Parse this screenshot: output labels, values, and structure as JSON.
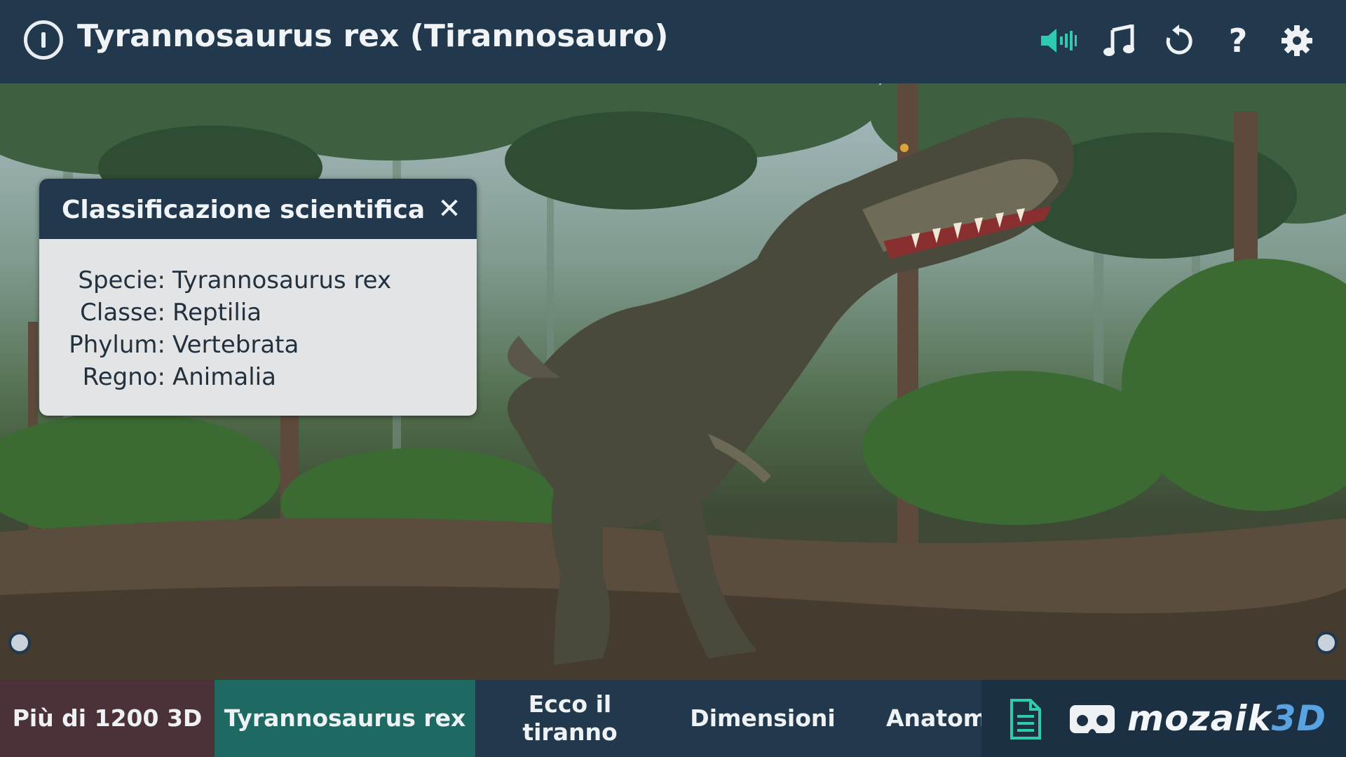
{
  "header": {
    "title": "Tyrannosaurus rex (Tirannosauro)",
    "icons": [
      "power-icon",
      "speaker-icon",
      "music-note-icon",
      "refresh-icon",
      "help-icon",
      "gear-icon"
    ],
    "accent_color": "#2fcbb0"
  },
  "panel": {
    "title": "Classificazione scientifica",
    "close_symbol": "✕",
    "rows": [
      {
        "label": "Specie:",
        "value": "Tyrannosaurus rex"
      },
      {
        "label": "Classe:",
        "value": "Reptilia"
      },
      {
        "label": "Phylum:",
        "value": "Vertebrata"
      },
      {
        "label": "Regno:",
        "value": "Animalia"
      }
    ]
  },
  "bottom": {
    "tabs": [
      {
        "label": "Più di 1200 3D"
      },
      {
        "label": "Tyrannosaurus rex"
      },
      {
        "label": "Ecco il tiranno"
      },
      {
        "label": "Dimensioni"
      },
      {
        "label": "Anatomia"
      }
    ],
    "icons": [
      "document-icon",
      "vr-headset-icon"
    ],
    "logo_main": "mozaik",
    "logo_accent": "3D"
  }
}
